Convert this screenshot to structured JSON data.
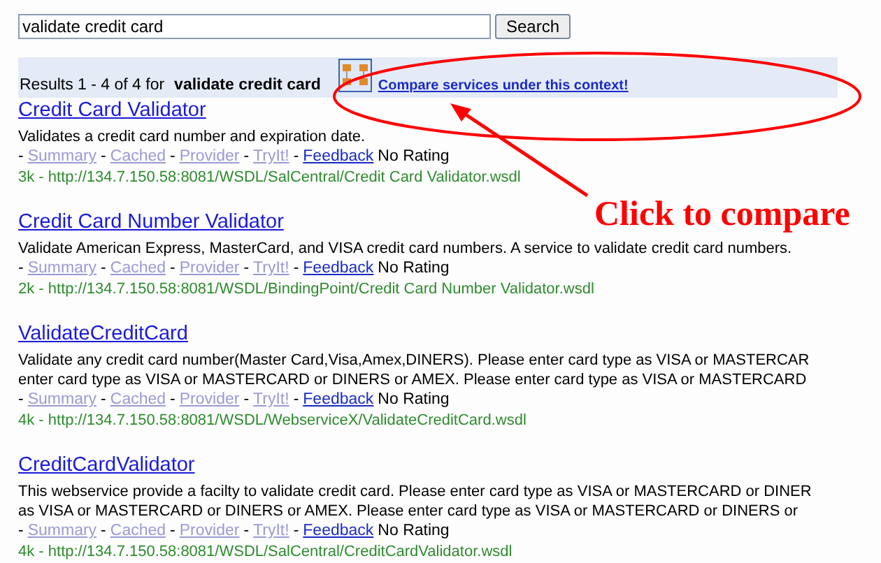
{
  "search": {
    "value": "validate credit card",
    "button": "Search"
  },
  "results_bar": {
    "summary": "Results 1 - 4 of 4 for",
    "query": "validate credit card",
    "compare_link": "Compare services under this context!"
  },
  "results": [
    {
      "title": "Credit Card Validator",
      "description": [
        "Validates a credit card number and expiration date."
      ],
      "links": [
        {
          "label": "Summary",
          "dimmed": true
        },
        {
          "label": "Cached",
          "dimmed": true
        },
        {
          "label": "Provider",
          "dimmed": true
        },
        {
          "label": "TryIt!",
          "dimmed": true
        },
        {
          "label": "Feedback",
          "dimmed": false
        }
      ],
      "separator": "-",
      "rating": "No Rating",
      "url": "3k - http://134.7.150.58:8081/WSDL/SalCentral/Credit Card Validator.wsdl"
    },
    {
      "title": "Credit Card Number Validator",
      "description": [
        "Validate American Express, MasterCard, and VISA credit card numbers. A service to validate credit card numbers."
      ],
      "links": [
        {
          "label": "Summary",
          "dimmed": true
        },
        {
          "label": "Cached",
          "dimmed": true
        },
        {
          "label": "Provider",
          "dimmed": true
        },
        {
          "label": "TryIt!",
          "dimmed": true
        },
        {
          "label": "Feedback",
          "dimmed": false
        }
      ],
      "separator": "-",
      "rating": "No Rating",
      "url": "2k - http://134.7.150.58:8081/WSDL/BindingPoint/Credit Card Number Validator.wsdl"
    },
    {
      "title": "ValidateCreditCard",
      "description": [
        "Validate any credit card number(Master Card,Visa,Amex,DINERS). Please enter card type as VISA or MASTERCAR",
        "enter card type as VISA or MASTERCARD or DINERS or AMEX. Please enter card type as VISA or MASTERCARD"
      ],
      "links": [
        {
          "label": "Summary",
          "dimmed": true
        },
        {
          "label": "Cached",
          "dimmed": true
        },
        {
          "label": "Provider",
          "dimmed": true
        },
        {
          "label": "TryIt!",
          "dimmed": true
        },
        {
          "label": "Feedback",
          "dimmed": false
        }
      ],
      "separator": "-",
      "rating": "No Rating",
      "url": "4k - http://134.7.150.58:8081/WSDL/WebserviceX/ValidateCreditCard.wsdl"
    },
    {
      "title": "CreditCardValidator",
      "description": [
        "This webservice provide a facilty to validate credit card. Please enter card type as VISA or MASTERCARD or DINER",
        "as VISA or MASTERCARD or DINERS or AMEX. Please enter card type as VISA or MASTERCARD or DINERS or"
      ],
      "links": [
        {
          "label": "Summary",
          "dimmed": true
        },
        {
          "label": "Cached",
          "dimmed": true
        },
        {
          "label": "Provider",
          "dimmed": true
        },
        {
          "label": "TryIt!",
          "dimmed": true
        },
        {
          "label": "Feedback",
          "dimmed": false
        }
      ],
      "separator": "-",
      "rating": "No Rating",
      "url": "4k - http://134.7.150.58:8081/WSDL/SalCentral/CreditCardValidator.wsdl"
    }
  ],
  "annotation": {
    "text": "Click to compare"
  }
}
